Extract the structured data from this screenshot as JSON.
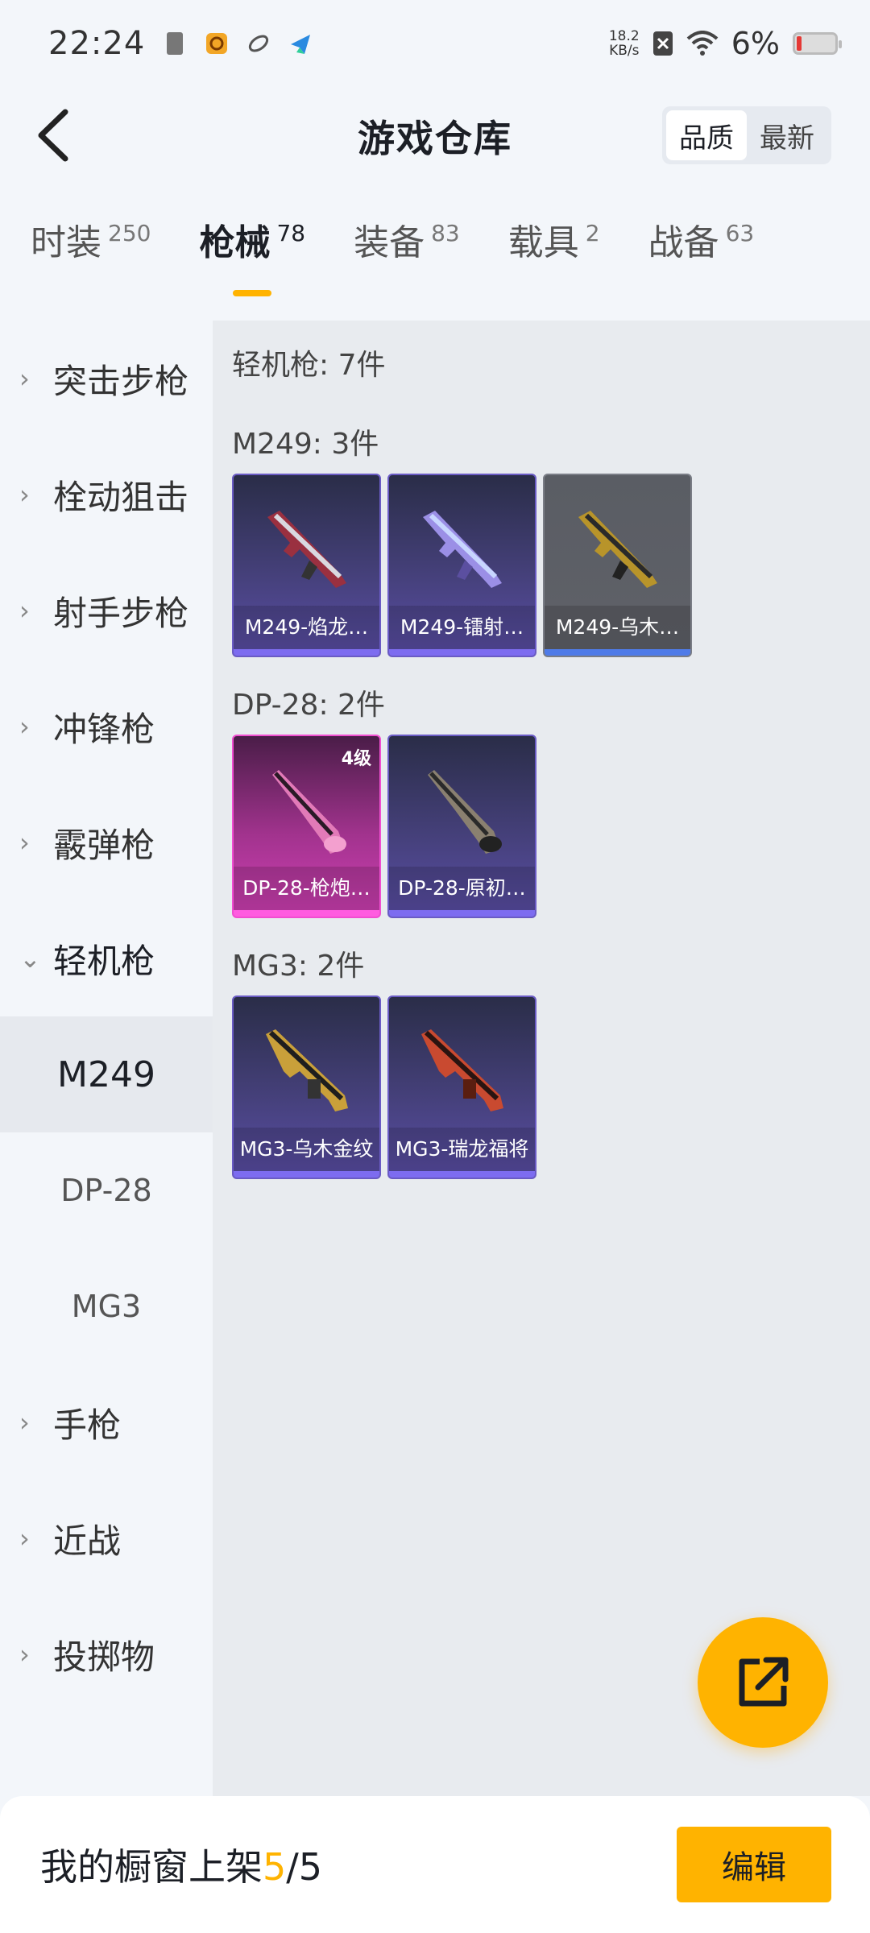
{
  "status_bar": {
    "time": "22:24",
    "net_speed_value": "18.2",
    "net_speed_unit": "KB/s",
    "battery": "6%",
    "icons": [
      "sim-icon",
      "app-icon",
      "loop-icon",
      "paper-plane-icon",
      "x-icon",
      "wifi-icon",
      "battery-icon"
    ]
  },
  "header": {
    "title": "游戏仓库",
    "sort_options": [
      "品质",
      "最新"
    ],
    "sort_active": "品质"
  },
  "category_tabs": [
    {
      "label": "时装",
      "count": "250"
    },
    {
      "label": "枪械",
      "count": "78",
      "active": true
    },
    {
      "label": "装备",
      "count": "83"
    },
    {
      "label": "载具",
      "count": "2"
    },
    {
      "label": "战备",
      "count": "63"
    }
  ],
  "sidebar": {
    "items": [
      "突击步枪",
      "栓动狙击",
      "射手步枪",
      "冲锋枪",
      "霰弹枪",
      "轻机枪",
      "手枪",
      "近战",
      "投掷物"
    ],
    "expanded": "轻机枪",
    "sub_items": [
      "M249",
      "DP-28",
      "MG3"
    ],
    "active_sub": "M249"
  },
  "content": {
    "group_title": "轻机枪: 7件",
    "sections": [
      {
        "title": "M249: 3件",
        "items": [
          {
            "name": "M249-焰龙…",
            "style": "purple"
          },
          {
            "name": "M249-镭射…",
            "style": "purple"
          },
          {
            "name": "M249-乌木…",
            "style": "gray"
          }
        ]
      },
      {
        "title": "DP-28: 2件",
        "items": [
          {
            "name": "DP-28-枪炮…",
            "style": "pink",
            "level": "4级"
          },
          {
            "name": "DP-28-原初…",
            "style": "purple"
          }
        ]
      },
      {
        "title": "MG3: 2件",
        "items": [
          {
            "name": "MG3-乌木金纹",
            "style": "purple"
          },
          {
            "name": "MG3-瑞龙福将",
            "style": "purple"
          }
        ]
      }
    ]
  },
  "fab": {
    "icon": "share-external-icon"
  },
  "bottom": {
    "shelf_label": "我的橱窗上架",
    "shelf_current": "5",
    "shelf_sep": "/",
    "shelf_total": "5",
    "edit_label": "编辑"
  },
  "colors": {
    "accent": "#ffb300",
    "background": "#f3f6fa",
    "content_bg": "#e8ebef"
  }
}
